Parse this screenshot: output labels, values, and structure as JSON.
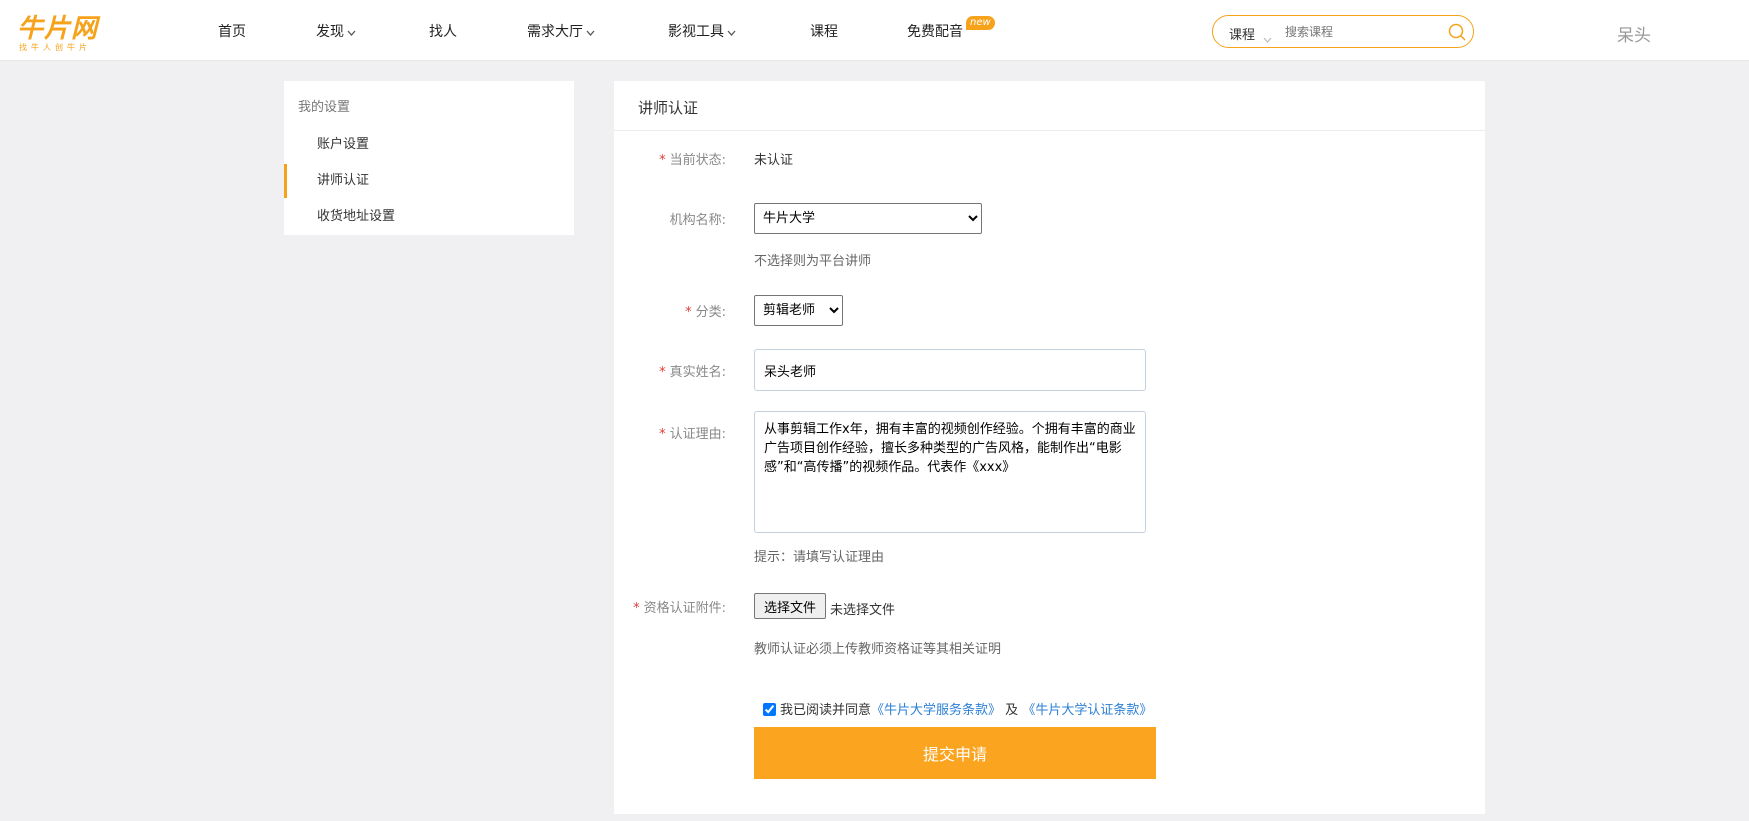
{
  "header": {
    "logo_text": "牛片网",
    "logo_slogan": "找牛人创牛片",
    "nav": [
      {
        "label": "首页"
      },
      {
        "label": "发现"
      },
      {
        "label": "找人"
      },
      {
        "label": "需求大厅"
      },
      {
        "label": "影视工具"
      },
      {
        "label": "课程"
      },
      {
        "label": "免费配音",
        "badge": "new"
      }
    ],
    "search": {
      "category": "课程",
      "placeholder": "搜索课程"
    },
    "user": "呆头"
  },
  "sidebar": {
    "title": "我的设置",
    "items": [
      {
        "label": "账户设置"
      },
      {
        "label": "讲师认证"
      },
      {
        "label": "收货地址设置"
      }
    ]
  },
  "form": {
    "title": "讲师认证",
    "status": {
      "label": "当前状态:",
      "value": "未认证"
    },
    "org": {
      "label": "机构名称:",
      "selected": "牛片大学",
      "hint": "不选择则为平台讲师"
    },
    "category": {
      "label": "分类:",
      "selected": "剪辑老师"
    },
    "real_name": {
      "label": "真实姓名:",
      "value": "呆头老师"
    },
    "reason": {
      "label": "认证理由:",
      "value": "从事剪辑工作x年，拥有丰富的视频创作经验。个拥有丰富的商业广告项目创作经验，擅长多种类型的广告风格，能制作出“电影感”和“高传播”的视频作品。代表作《xxx》",
      "hint": "提示：请填写认证理由"
    },
    "attachment": {
      "label": "资格认证附件:",
      "button": "选择文件",
      "status": "未选择文件",
      "hint": "教师认证必须上传教师资格证等其相关证明"
    },
    "agreement": {
      "prefix": "我已阅读并同意",
      "link1": "《牛片大学服务条款》",
      "middle": "及",
      "link2": "《牛片大学认证条款》",
      "checked": true
    },
    "submit": "提交申请"
  },
  "colors": {
    "accent": "#f6a21a",
    "link": "#2c7fd6",
    "required": "#e53935"
  }
}
